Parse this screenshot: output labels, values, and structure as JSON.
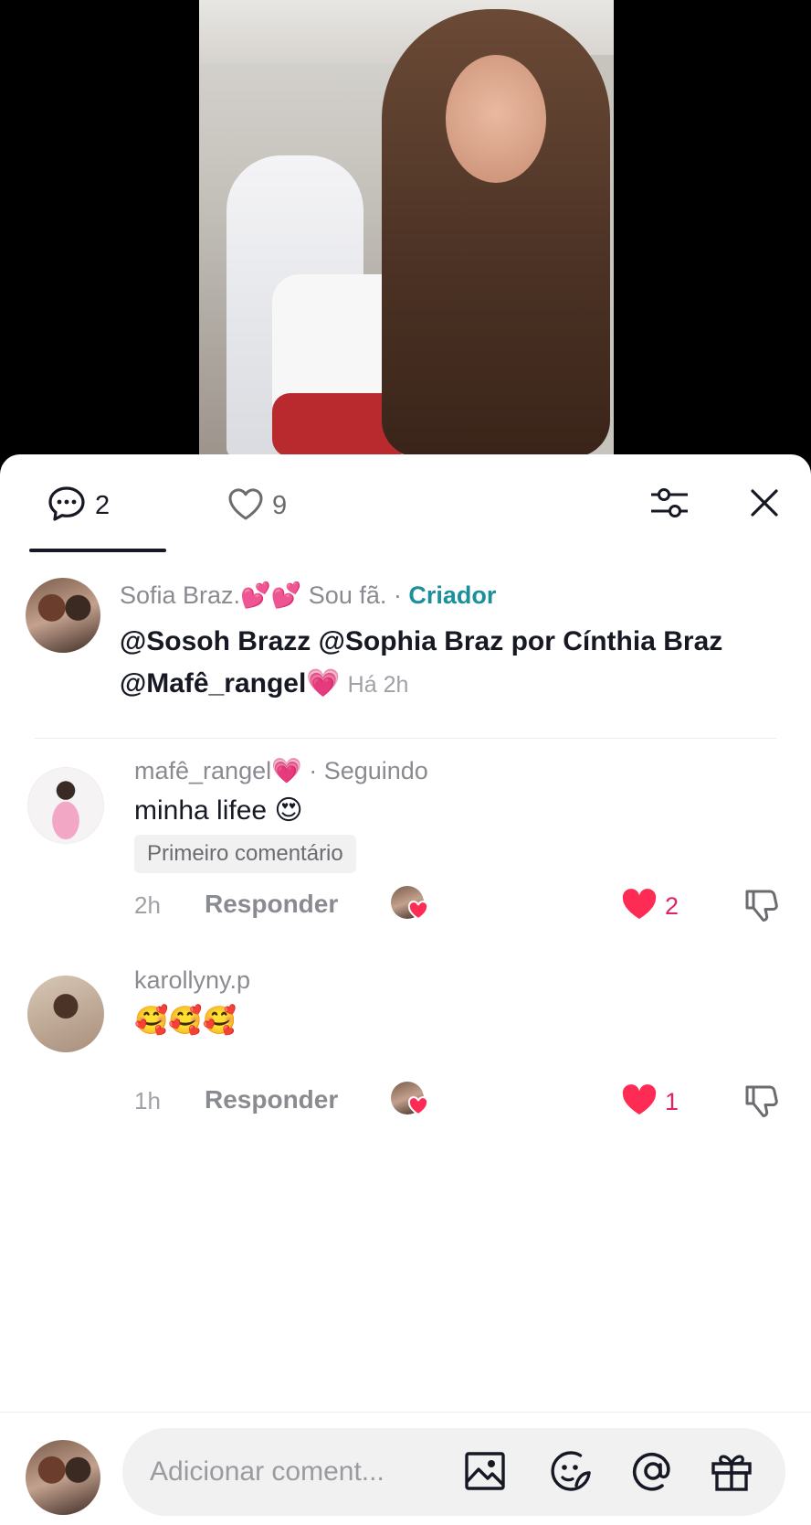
{
  "tabs": {
    "comments_count": "2",
    "likes_count": "9"
  },
  "caption": {
    "author": "Sofia Braz.💕💕 Sou fã.",
    "separator": " · ",
    "creator_label": "Criador",
    "text": "@Sosoh Brazz  @Sophia Braz por Cínthia Braz  @Mafê_rangel💗",
    "time": "Há 2h"
  },
  "comments": [
    {
      "user": "mafê_rangel💗",
      "status": " · Seguindo",
      "text": "minha lifee 😍",
      "badge": "Primeiro comentário",
      "time": "2h",
      "reply_label": "Responder",
      "likes": "2"
    },
    {
      "user": "karollyny.p",
      "status": "",
      "text": "🥰🥰🥰",
      "time": "1h",
      "reply_label": "Responder",
      "likes": "1"
    }
  ],
  "input": {
    "placeholder": "Adicionar coment..."
  },
  "colors": {
    "creator_tag": "#1b8f9a",
    "like_red": "#e0245e",
    "text_dark": "#161823",
    "text_muted": "#8a8b91"
  },
  "icons": [
    "comment-icon",
    "heart-outline-icon",
    "filter-icon",
    "close-icon",
    "heart-filled-icon",
    "dislike-icon",
    "image-icon",
    "emoji-icon",
    "mention-icon",
    "gift-icon"
  ]
}
